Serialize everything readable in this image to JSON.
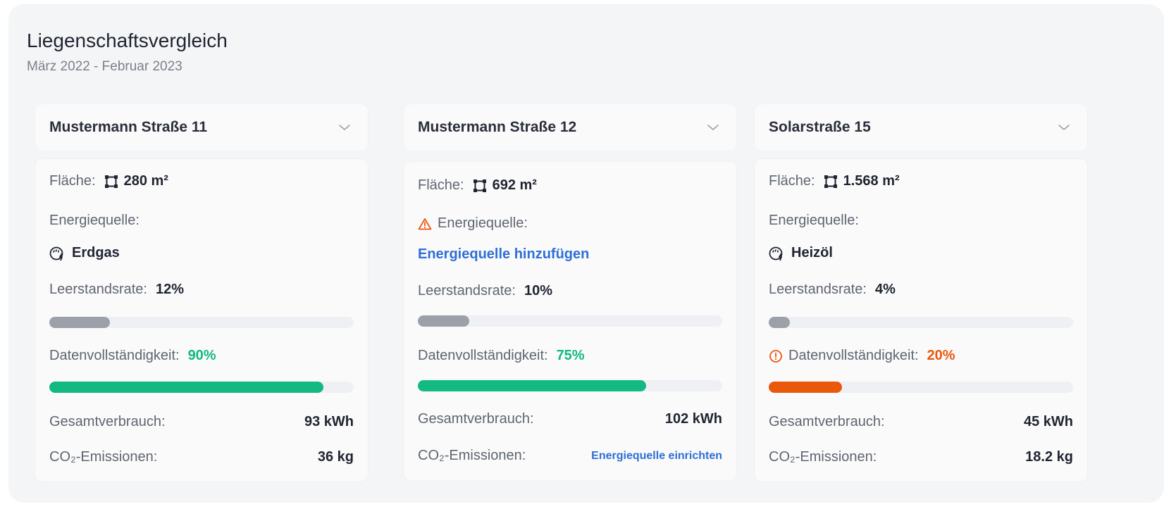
{
  "header": {
    "title": "Liegenschaftsvergleich",
    "subtitle": "März 2022 - Februar 2023"
  },
  "properties": [
    {
      "name": "Mustermann Straße 11",
      "flaeche_label": "Fläche:",
      "flaeche_value": "280 m²",
      "energiequelle_label": "Energiequelle:",
      "energiequelle_value": "Erdgas",
      "energiequelle_icon": "gas-meter-icon",
      "leerstand_label": "Leerstandsrate:",
      "leerstand_value": "12%",
      "leerstand_fraction": 0.2,
      "daten_label": "Datenvollständigkeit:",
      "daten_value": "90%",
      "daten_fraction": 0.9,
      "daten_color": "#12b981",
      "gesamt_label": "Gesamtverbrauch:",
      "gesamt_value": "93 kWh",
      "co2_label": "CO₂-Emissionen:",
      "co2_value": "36 kg"
    },
    {
      "name": "Mustermann Straße 12",
      "flaeche_label": "Fläche:",
      "flaeche_value": "692 m²",
      "energiequelle_label": "Energiequelle:",
      "energiequelle_warning_icon": "warning-triangle-icon",
      "energiequelle_link": "Energiequelle hinzufügen",
      "leerstand_label": "Leerstandsrate:",
      "leerstand_value": "10%",
      "leerstand_fraction": 0.17,
      "daten_label": "Datenvollständigkeit:",
      "daten_value": "75%",
      "daten_fraction": 0.75,
      "daten_color": "#12b981",
      "gesamt_label": "Gesamtverbrauch:",
      "gesamt_value": "102 kWh",
      "co2_label": "CO₂-Emissionen:",
      "co2_link": "Energiequelle einrichten"
    },
    {
      "name": "Solarstraße 15",
      "flaeche_label": "Fläche:",
      "flaeche_value": "1.568 m²",
      "energiequelle_label": "Energiequelle:",
      "energiequelle_value": "Heizöl",
      "energiequelle_icon": "gas-meter-icon",
      "leerstand_label": "Leerstandsrate:",
      "leerstand_value": "4%",
      "leerstand_fraction": 0.07,
      "daten_warning_icon": "alert-circle-icon",
      "daten_label": "Datenvollständigkeit:",
      "daten_value": "20%",
      "daten_fraction": 0.24,
      "daten_color": "#ea580c",
      "gesamt_label": "Gesamtverbrauch:",
      "gesamt_value": "45 kWh",
      "co2_label": "CO₂-Emissionen:",
      "co2_value": "18.2 kg"
    }
  ],
  "colors": {
    "positive": "#12b981",
    "warning": "#ea580c",
    "link": "#2e6fd6",
    "bar_neutral": "#9ca0a8"
  }
}
